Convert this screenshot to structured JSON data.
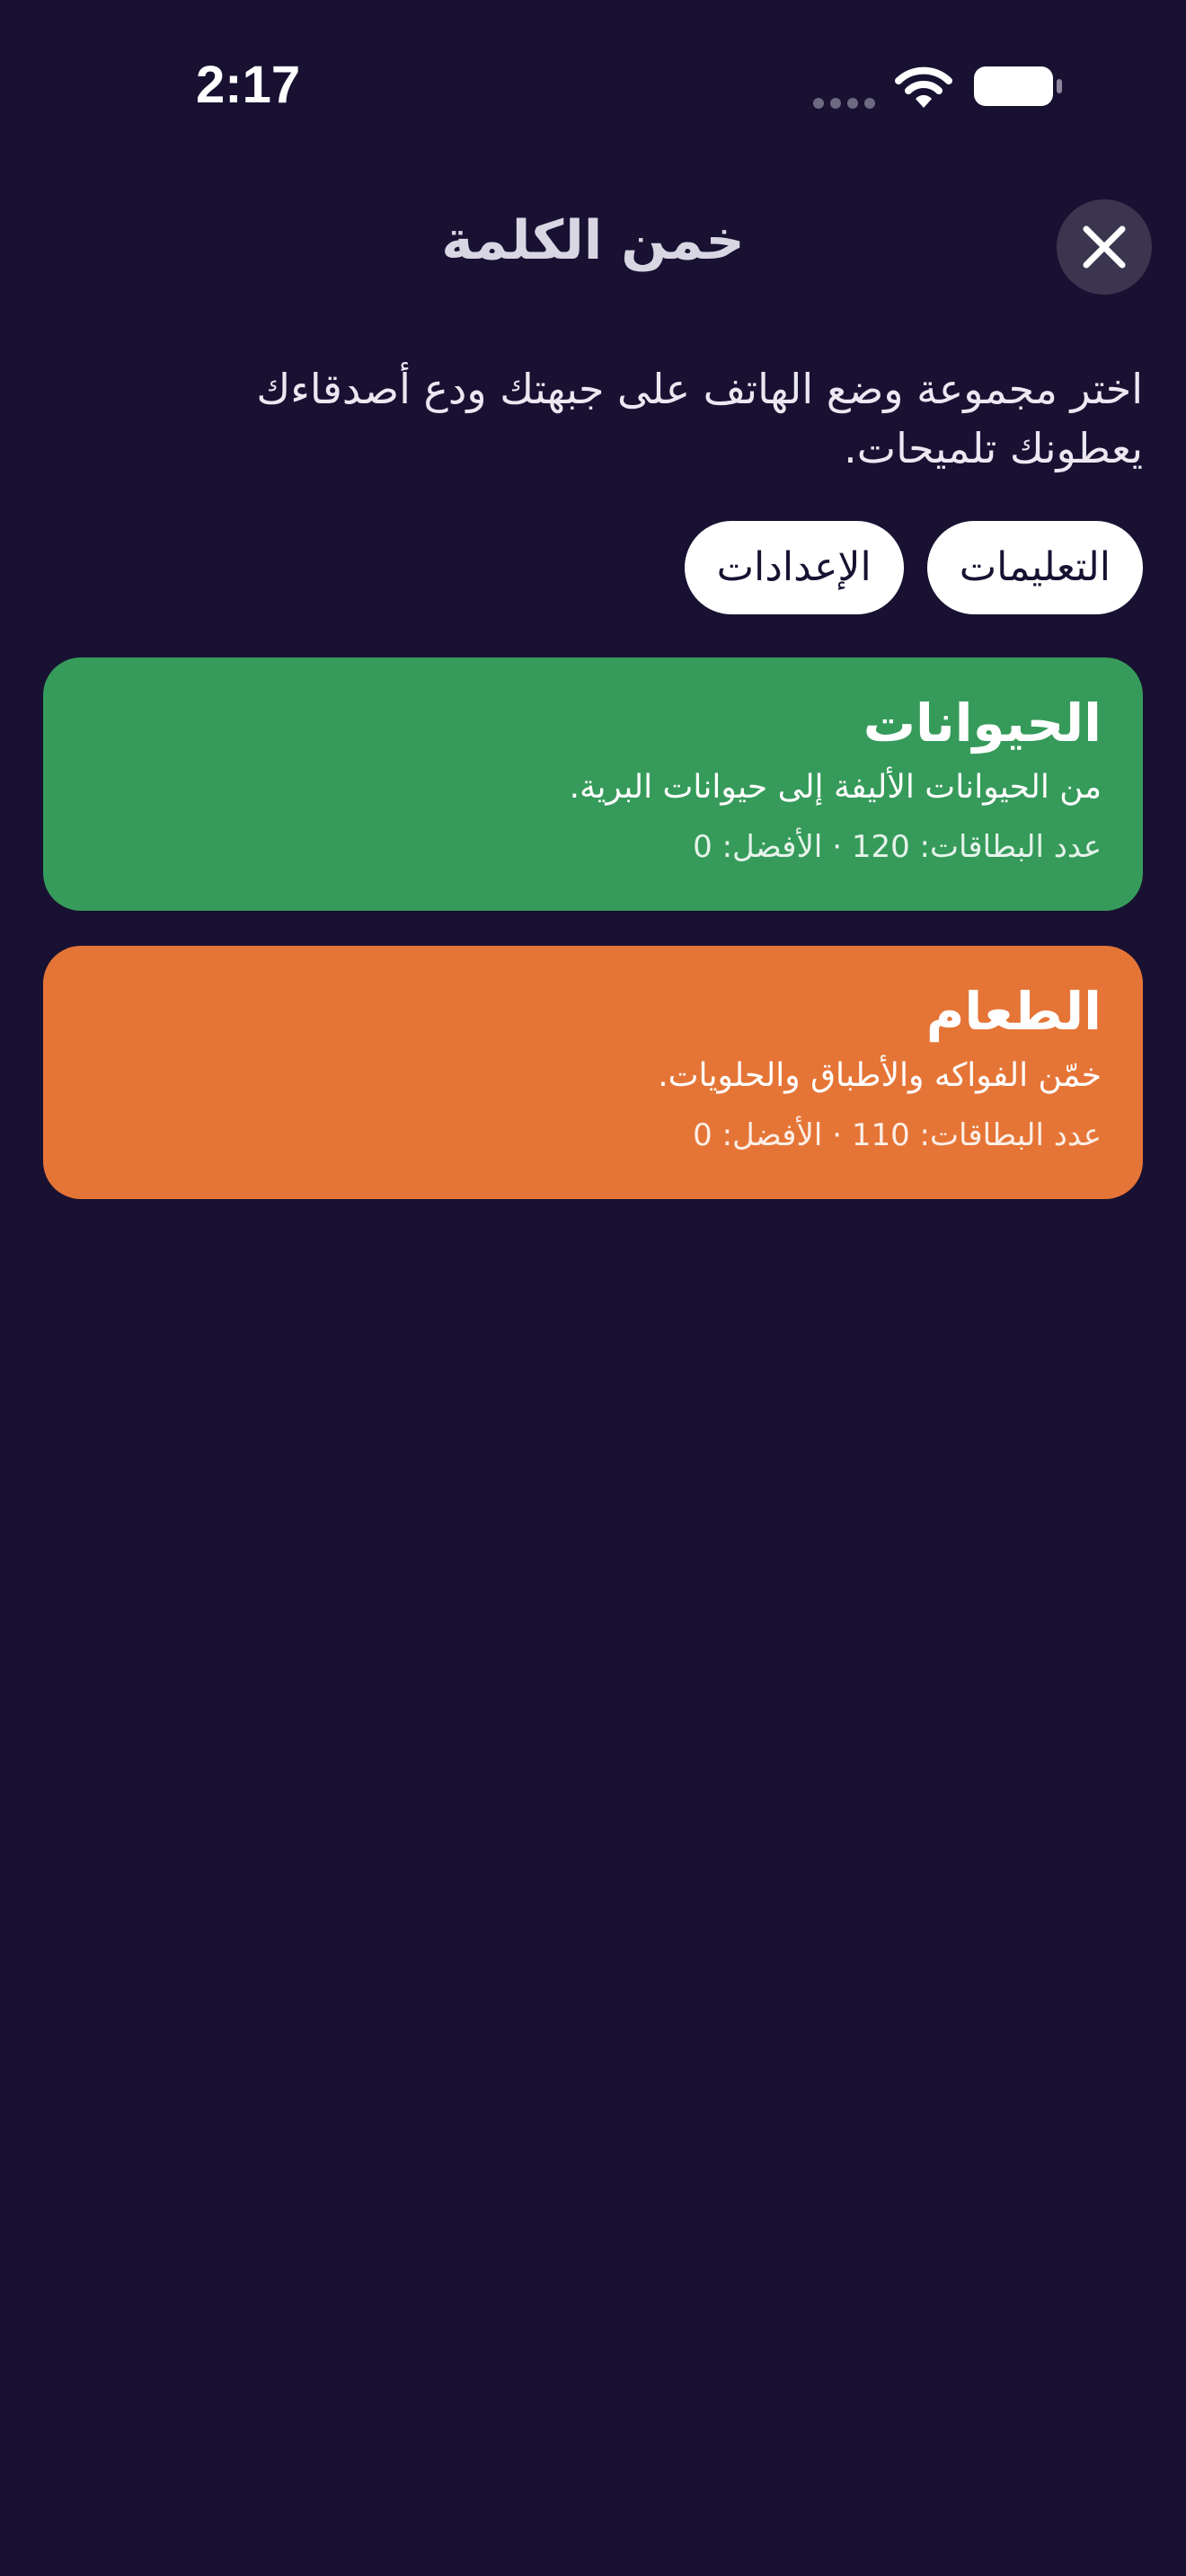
{
  "status_bar": {
    "time": "2:17"
  },
  "header": {
    "title": "خمن الكلمة"
  },
  "intro": {
    "text": "اختر مجموعة وضع الهاتف على جبهتك ودع أصدقاءك يعطونك تلميحات."
  },
  "buttons": {
    "instructions": "التعليمات",
    "settings": "الإعدادات"
  },
  "categories": [
    {
      "title": "الحيوانات",
      "description": "من الحيوانات الأليفة إلى حيوانات البرية.",
      "stats": "عدد البطاقات: 120 · الأفضل: 0",
      "color": "#369b5a"
    },
    {
      "title": "الطعام",
      "description": "خمّن الفواكه والأطباق والحلويات.",
      "stats": "عدد البطاقات: 110 · الأفضل: 0",
      "color": "#e57537"
    }
  ],
  "colors": {
    "background": "#191132",
    "close_button_bg": "#3b3550",
    "pill_bg": "#ffffff"
  },
  "icons": {
    "close": "close-icon",
    "wifi": "wifi-icon",
    "battery": "battery-icon",
    "signal": "signal-dots-icon"
  }
}
